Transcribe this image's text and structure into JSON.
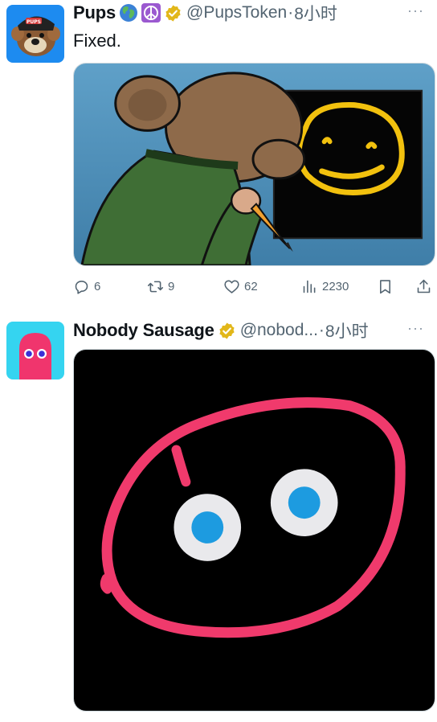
{
  "tweets": [
    {
      "display_name": "Pups",
      "emojis": [
        "globe-europe-africa-icon",
        "peace-symbol-icon"
      ],
      "handle": "@PupsToken",
      "separator": "·",
      "time": "8小时",
      "more": "···",
      "text": "Fixed.",
      "stats": {
        "replies": "6",
        "retweets": "9",
        "likes": "62",
        "views": "2230"
      }
    },
    {
      "display_name": "Nobody Sausage",
      "handle": "@nobod...",
      "separator": "·",
      "time": "8小时",
      "more": "···"
    }
  ],
  "colors": {
    "verified_badge": "#E2B719",
    "avatar2_bg": "#35D4F0",
    "ghost_pink": "#F0356D",
    "drawing_pink": "#F03A6C",
    "eye_blue": "#1D9BE0",
    "smiley_yellow": "#F2C10E",
    "secondary_text": "#536471"
  }
}
